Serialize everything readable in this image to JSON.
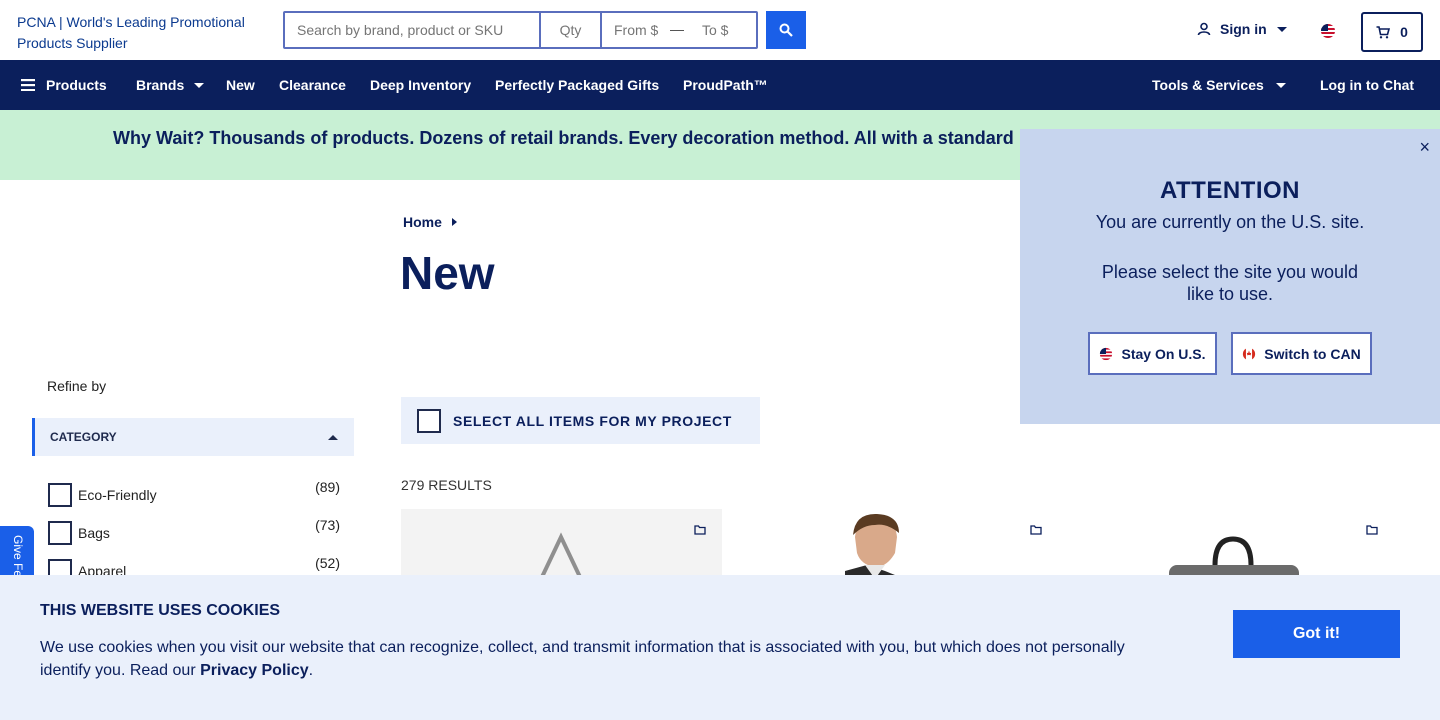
{
  "header": {
    "logo_alt": "PCNA | World's Leading Promotional Products Supplier",
    "search_placeholder": "Search by brand, product or SKU",
    "qty_placeholder": "Qty",
    "price_from_placeholder": "From $",
    "price_to_placeholder": "To $",
    "sign_in_label": "Sign in",
    "cart_count": "0"
  },
  "nav": {
    "products": "Products",
    "brands": "Brands",
    "new": "New",
    "clearance": "Clearance",
    "deep_inventory": "Deep Inventory",
    "perfectly_packaged_gifts": "Perfectly Packaged Gifts",
    "proudpath": "ProudPath™",
    "tools_services": "Tools & Services",
    "log_in_to_chat": "Log in to Chat"
  },
  "promo": {
    "text": "Why Wait? Thousands of products. Dozens of retail brands. Every decoration method. All with a standard"
  },
  "breadcrumb": {
    "home": "Home"
  },
  "page": {
    "title": "New",
    "select_all_label": "SELECT ALL ITEMS FOR MY PROJECT",
    "results_label": "279 RESULTS"
  },
  "sidebar": {
    "refine_label": "Refine by",
    "category_label": "CATEGORY",
    "facets": [
      {
        "label": "Eco-Friendly",
        "count": "(89)"
      },
      {
        "label": "Bags",
        "count": "(73)"
      },
      {
        "label": "Apparel",
        "count": "(52)"
      }
    ]
  },
  "feedback": {
    "label": "Give Feedback"
  },
  "site_popup": {
    "title": "ATTENTION",
    "line1": "You are currently on the U.S. site.",
    "line2": "Please select the site you would like to use.",
    "stay_label": "Stay On U.S.",
    "switch_label": "Switch to CAN",
    "close_symbol": "×"
  },
  "cookie": {
    "title": "THIS WEBSITE USES COOKIES",
    "text": "We use cookies when you visit our website that can recognize, collect, and transmit information that is associated with you, but which does not personally identify you. Read our",
    "link_label": "Privacy Policy",
    "period": ".",
    "button_label": "Got it!"
  },
  "icons": {
    "search": "search-icon",
    "user": "user-icon",
    "flag_us": "us-flag-icon",
    "flag_ca": "canada-flag-icon",
    "cart": "cart-icon",
    "menu": "hamburger-icon",
    "folder": "folder-icon"
  },
  "colors": {
    "navy": "#0b1f5c",
    "accent_blue": "#1a5fe8",
    "promo_green": "#c8f0d4",
    "popup_blue": "#c7d5ee",
    "light_panel": "#eaf0fb"
  }
}
